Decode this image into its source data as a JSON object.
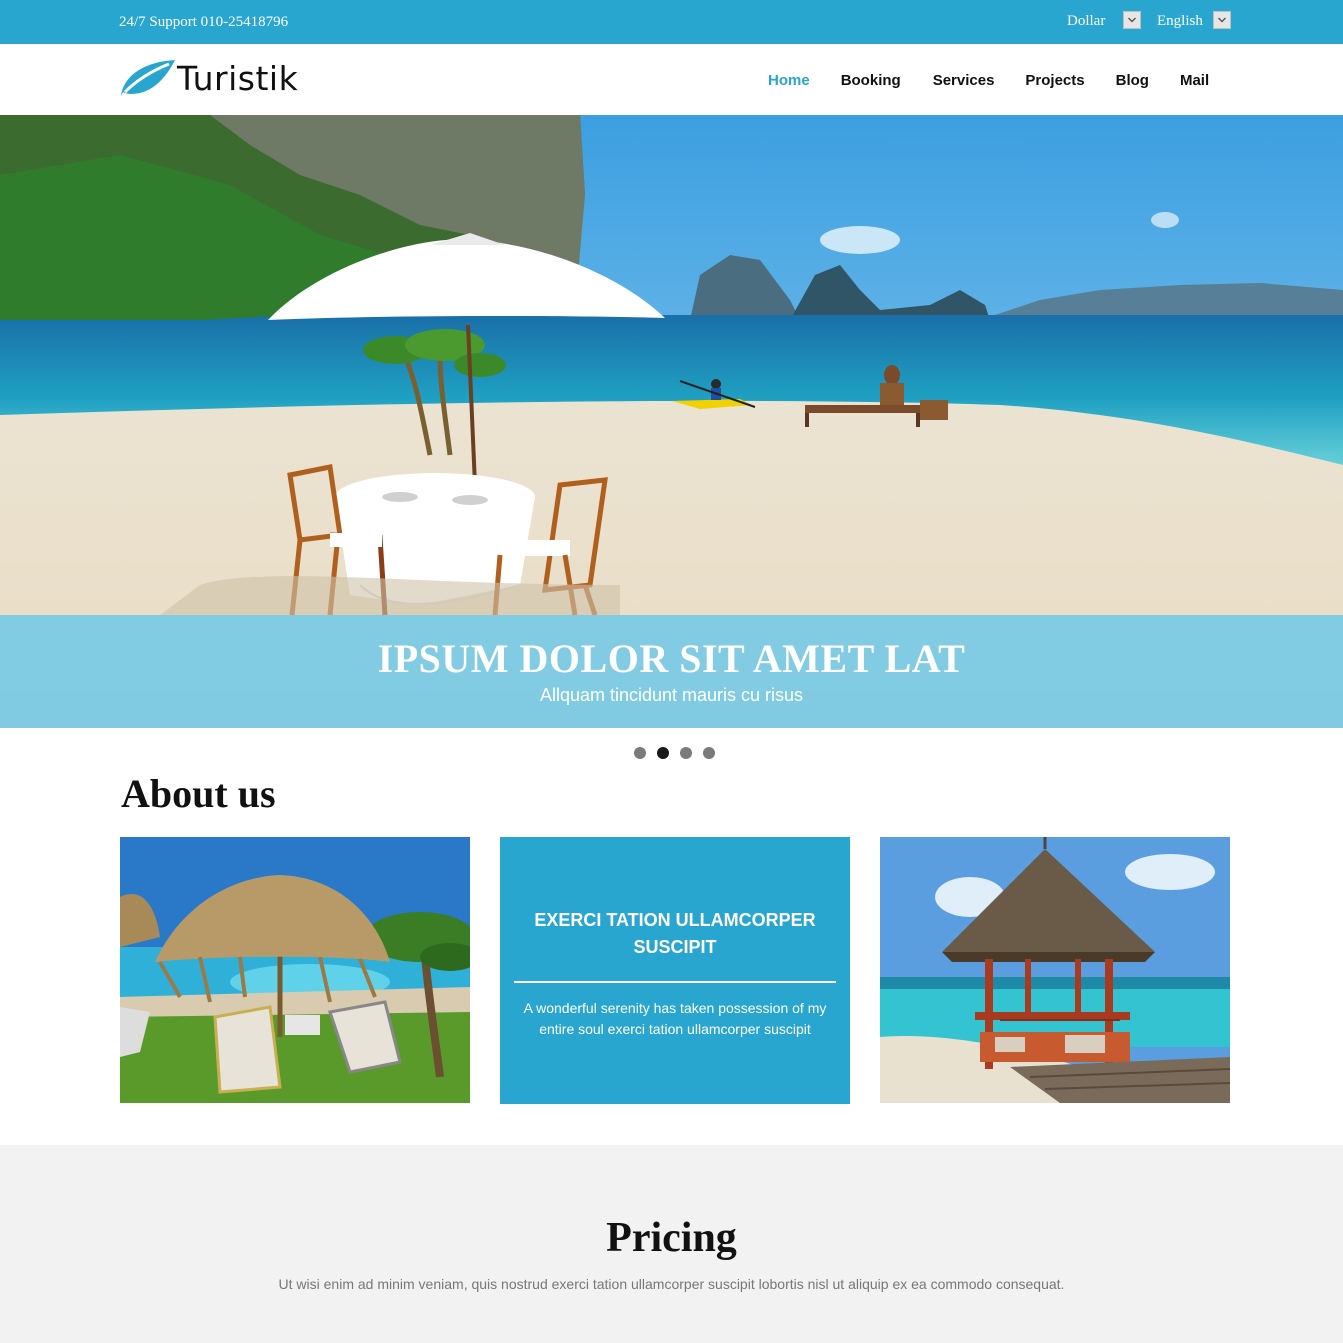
{
  "topbar": {
    "support": "24/7 Support 010-25418796",
    "currency": "Dollar",
    "language": "English"
  },
  "header": {
    "logo_text": "Turistik",
    "nav": [
      "Home",
      "Booking",
      "Services",
      "Projects",
      "Blog",
      "Mail"
    ],
    "active_nav": "Home"
  },
  "hero": {
    "title": "IPSUM DOLOR SIT AMET LAT",
    "subtitle": "Allquam tincidunt mauris cu risus",
    "slide_count": 4,
    "active_slide": 2
  },
  "about": {
    "title": "About us",
    "card_title": "EXERCI TATION ULLAMCORPER SUSCIPIT",
    "card_text": "A wonderful serenity has taken possession of my entire soul exerci tation ullamcorper suscipit"
  },
  "pricing": {
    "title": "Pricing",
    "text": "Ut wisi enim ad minim veniam, quis nostrud exerci tation ullamcorper suscipit lobortis nisl ut aliquip ex ea commodo consequat."
  },
  "colors": {
    "accent": "#29a6cf",
    "caption_overlay": "#6ec8e8",
    "pricing_bg": "#f2f2f2"
  },
  "icons": [
    "leaf-logo-icon",
    "chevron-down-icon"
  ]
}
